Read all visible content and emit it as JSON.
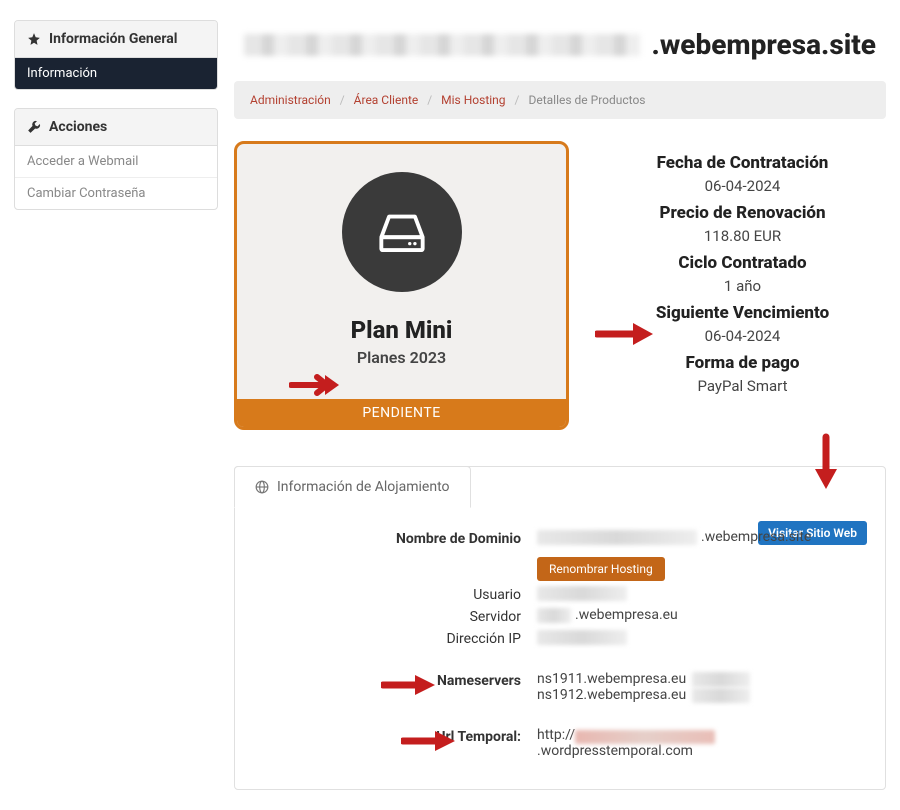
{
  "page_title_suffix": ".webempresa.site",
  "sidebar": {
    "info_header": "Información General",
    "info_item": "Información",
    "actions_header": "Acciones",
    "actions_items": [
      "Acceder a Webmail",
      "Cambiar Contraseña"
    ]
  },
  "breadcrumb": {
    "items": [
      "Administración",
      "Área Cliente",
      "Mis Hosting"
    ],
    "current": "Detalles de Productos"
  },
  "product": {
    "name": "Plan Mini",
    "subtitle": "Planes 2023",
    "status": "PENDIENTE"
  },
  "details": {
    "hire_date_label": "Fecha de Contratación",
    "hire_date": "06-04-2024",
    "renewal_price_label": "Precio de Renovación",
    "renewal_price": "118.80 EUR",
    "cycle_label": "Ciclo Contratado",
    "cycle": "1 año",
    "next_due_label": "Siguiente Vencimiento",
    "next_due": "06-04-2024",
    "payment_label": "Forma de pago",
    "payment": "PayPal Smart"
  },
  "hosting": {
    "tab_label": "Información de Alojamiento",
    "domain_label": "Nombre de Dominio",
    "domain_suffix": ".webempresa.site",
    "visit_btn": "Visitar Sitio Web",
    "rename_btn": "Renombrar Hosting",
    "user_label": "Usuario",
    "server_label": "Servidor",
    "server_suffix": ".webempresa.eu",
    "ip_label": "Dirección IP",
    "ns_label": "Nameservers",
    "ns1": "ns1911.webempresa.eu",
    "ns2": "ns1912.webempresa.eu",
    "url_label": "Url Temporal:",
    "url_prefix": "http://",
    "url_suffix": ".wordpresstemporal.com"
  }
}
